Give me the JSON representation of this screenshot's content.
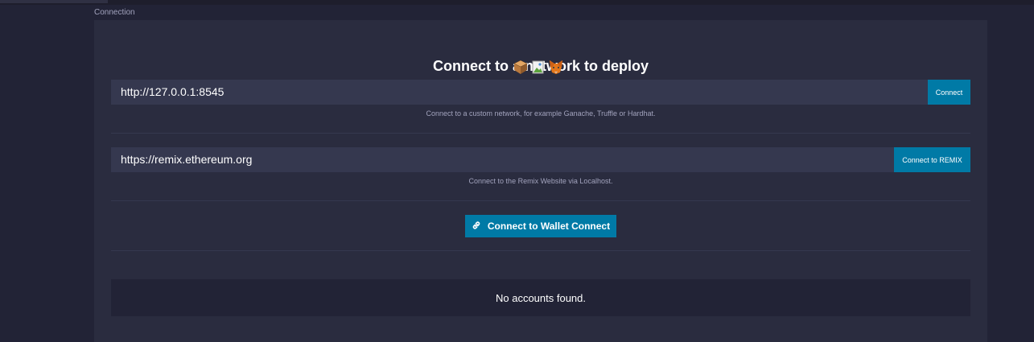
{
  "section_label": "Connection",
  "heading": "Connect to a network to deploy",
  "providers": [
    {
      "icon": "ganache-box-icon"
    },
    {
      "icon": "broken-image-icon"
    },
    {
      "icon": "metamask-fox-icon"
    }
  ],
  "custom_network": {
    "value": "http://127.0.0.1:8545",
    "button_label": "Connect",
    "hint": "Connect to a custom network, for example Ganache, Truffle or Hardhat."
  },
  "remix": {
    "value": "https://remix.ethereum.org",
    "button_label": "Connect to REMIX",
    "hint": "Connect to the Remix Website via Localhost."
  },
  "wallet_connect": {
    "label": "Connect to Wallet Connect",
    "icon": "link-icon"
  },
  "accounts": {
    "empty_message": "No accounts found."
  },
  "colors": {
    "background": "#222336",
    "panel": "#2a2c3f",
    "input": "#35384f",
    "accent": "#007aa6",
    "muted_text": "#a2a3bd"
  }
}
